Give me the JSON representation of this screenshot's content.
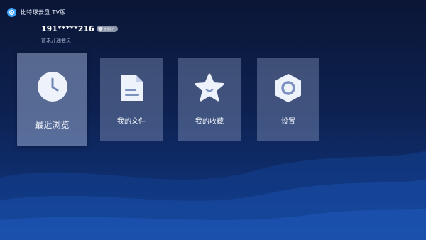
{
  "app": {
    "title": "比特球云盘 TV版",
    "logo_icon": "cloud-icon"
  },
  "user": {
    "id": "191*****216",
    "vip_badge_text": "普通用户",
    "member_status": "暂未开通会员"
  },
  "tiles": [
    {
      "label": "最近浏览",
      "icon": "clock-icon",
      "focused": true
    },
    {
      "label": "我的文件",
      "icon": "file-icon",
      "focused": false
    },
    {
      "label": "我的收藏",
      "icon": "star-icon",
      "focused": false
    },
    {
      "label": "设置",
      "icon": "settings-icon",
      "focused": false
    }
  ],
  "colors": {
    "background_top": "#0b1636",
    "background_bottom": "#123a85",
    "accent": "#3fa7ff",
    "tile": "#8798be"
  }
}
